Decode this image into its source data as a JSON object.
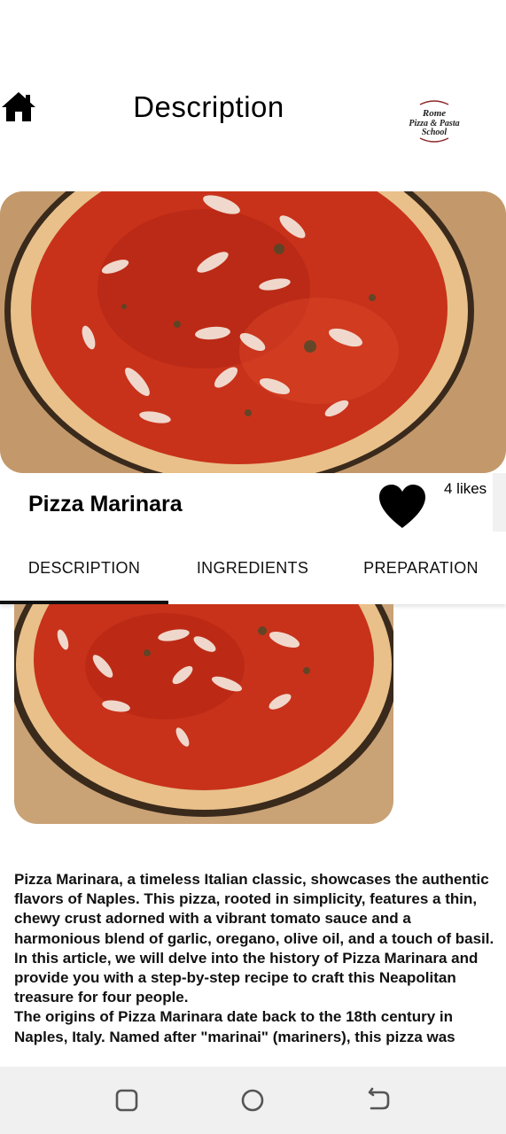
{
  "header": {
    "title": "Description",
    "home_icon": "home-icon",
    "logo_lines": [
      "Rome",
      "Pizza & Pasta",
      "School"
    ]
  },
  "recipe": {
    "name": "Pizza Marinara",
    "likes": "4 likes",
    "heart_icon": "heart-icon"
  },
  "tabs": [
    {
      "label": "DESCRIPTION",
      "selected": true
    },
    {
      "label": "INGREDIENTS",
      "selected": false
    },
    {
      "label": "PREPARATION",
      "selected": false
    }
  ],
  "description_text": "Pizza Marinara, a timeless Italian classic, showcases the authentic flavors of Naples. This pizza, rooted in simplicity, features a thin, chewy crust adorned with a vibrant tomato sauce and a harmonious blend of garlic, oregano, olive oil, and a touch of basil. In this article, we will delve into the history of Pizza Marinara and provide you with a step-by-step recipe to craft this Neapolitan treasure for four people.\nThe origins of Pizza Marinara date back to the 18th century in Naples, Italy. Named after \"marinai\" (mariners), this pizza was",
  "navbar": {
    "recent_icon": "recent-apps-icon",
    "home_icon": "circle-home-icon",
    "back_icon": "back-icon"
  },
  "colors": {
    "sauce": "#c8321a",
    "crust": "#e9c08a",
    "board": "#c9a276",
    "navbar": "#f0f0f0"
  }
}
